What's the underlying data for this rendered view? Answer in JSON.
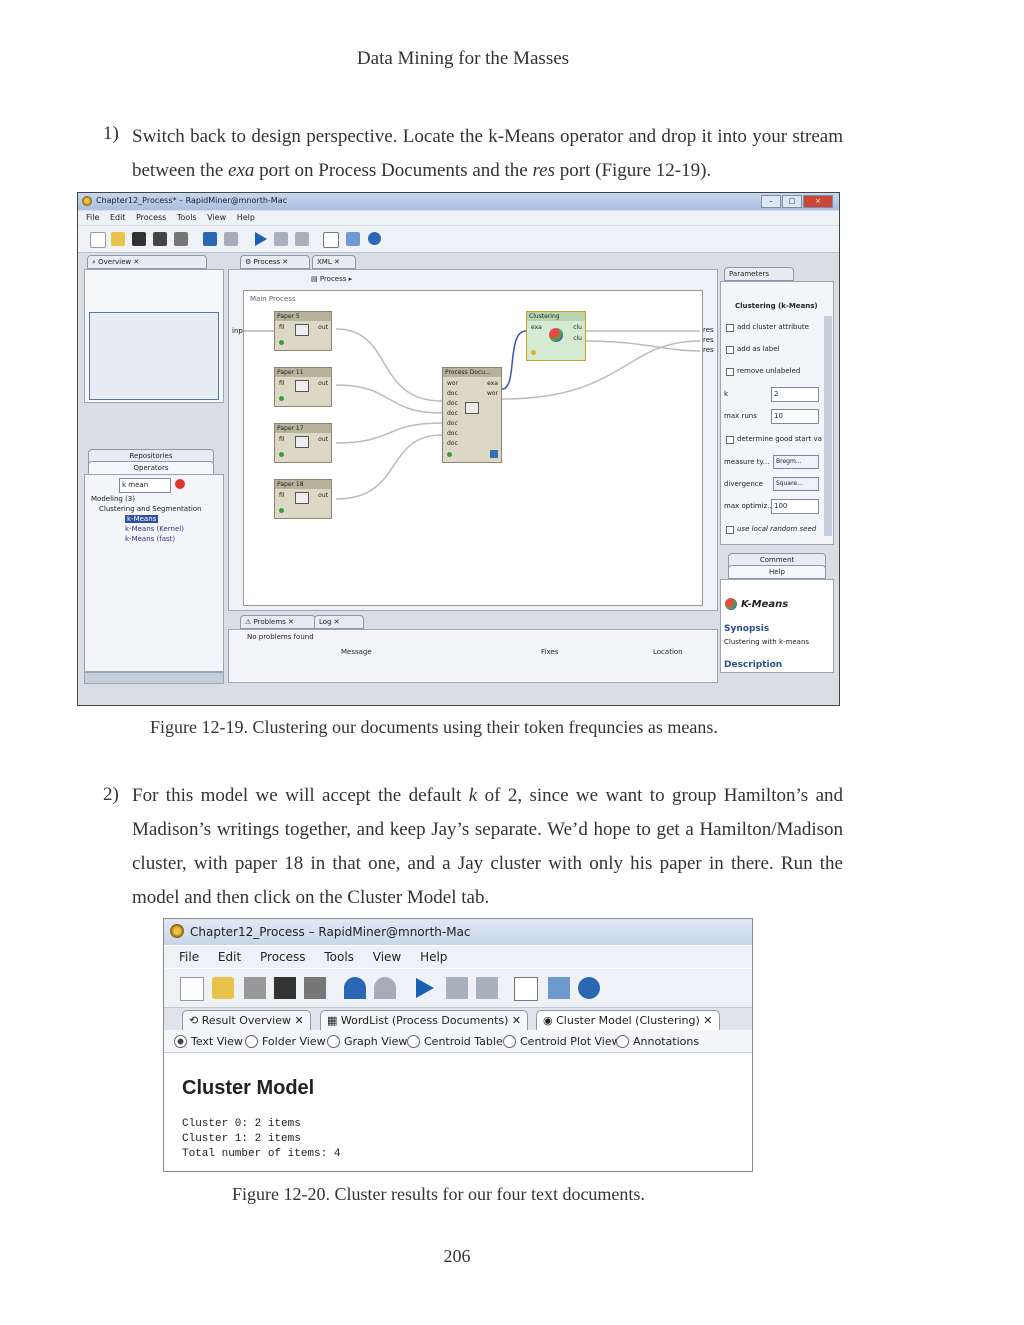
{
  "header": "Data Mining for the Masses",
  "steps": [
    {
      "number": "1)",
      "text": "Switch back to design perspective.  Locate the k-Means operator and drop it into your stream between the exa port on Process Documents and the res port (Figure 12-19)."
    },
    {
      "number": "2)",
      "text": "For this model we will accept the default k of 2, since we want to group Hamilton’s and Madison’s writings together, and keep Jay’s separate.   We’d hope to get a Hamilton/Madison cluster, with paper 18 in that one, and a Jay cluster with only his paper in there.  Run the model and then click on the Cluster Model tab."
    }
  ],
  "step1_parts": {
    "a": "Switch back to design perspective.  Locate the k-Means operator and drop it into your stream between the ",
    "exa": "exa",
    "b": " port on Process Documents and the ",
    "res": "res",
    "c": " port (Figure 12-19)."
  },
  "step2_parts": {
    "a": "For this model we will accept the default ",
    "k": "k",
    "b": " of 2, since we want to group Hamilton’s and Madison’s writings together, and keep Jay’s separate.   We’d hope to get a Hamilton/Madison cluster, with paper 18 in that one, and a Jay cluster with only his paper in there.  Run the model and then click on the Cluster Model tab."
  },
  "figure1": {
    "caption": "Figure 12-19.  Clustering our documents using their token frequncies as means.",
    "window_title": "Chapter12_Process* – RapidMiner@mnorth-Mac",
    "menu": [
      "File",
      "Edit",
      "Process",
      "Tools",
      "View",
      "Help"
    ],
    "overview_tab": "Overview",
    "process_tab": "Process",
    "xml_tab": "XML",
    "breadcrumb": "Process",
    "main_process_label": "Main Process",
    "operators": [
      {
        "name": "Paper 5",
        "port_in": "fil",
        "port_out": "out"
      },
      {
        "name": "Paper 11",
        "port_in": "fil",
        "port_out": "out"
      },
      {
        "name": "Paper 17",
        "port_in": "fil",
        "port_out": "out"
      },
      {
        "name": "Paper 18",
        "port_in": "fil",
        "port_out": "out"
      }
    ],
    "process_docs": {
      "name": "Process Docu...",
      "ports_in": [
        "wor",
        "doc",
        "doc",
        "doc",
        "doc",
        "doc",
        "doc"
      ],
      "ports_out": [
        "exa",
        "wor"
      ]
    },
    "clustering_op": {
      "name": "Clustering",
      "port_in": "exa",
      "ports_out": [
        "clu",
        "clu"
      ]
    },
    "canvas_left_port": "inp",
    "res_ports": [
      "res",
      "res",
      "res"
    ],
    "repositories_tab": "Repositories",
    "operators_tab": "Operators",
    "search_value": "k mean",
    "tree": [
      "Modeling (3)",
      "Clustering and Segmentation",
      "k-Means",
      "k-Means (Kernel)",
      "k-Means (fast)"
    ],
    "problems_tab": "Problems",
    "log_tab": "Log",
    "no_problems": "No problems found",
    "problem_columns": [
      "Message",
      "Fixes",
      "Location"
    ],
    "parameters_tab": "Parameters",
    "parameters_title": "Clustering (k-Means)",
    "params": {
      "add_cluster_attribute": "add cluster attribute",
      "add_as_label": "add as label",
      "remove_unlabeled": "remove unlabeled",
      "k_label": "k",
      "k_value": "2",
      "max_runs_label": "max runs",
      "max_runs_value": "10",
      "determine_good_start": "determine good start va",
      "measure_types_label": "measure ty...",
      "measure_types_value": "Bregm...",
      "divergence_label": "divergence",
      "divergence_value": "Square...",
      "max_optimization_label": "max optimiz...",
      "max_optimization_value": "100",
      "use_local_random_seed": "use local random seed"
    },
    "comment_tab": "Comment",
    "help_tab": "Help",
    "help_title": "K-Means",
    "help_synopsis_heading": "Synopsis",
    "help_synopsis": "Clustering with k-means",
    "help_description": "Description"
  },
  "figure2": {
    "caption": "Figure 12-20.  Cluster results for our four text documents.",
    "window_title": "Chapter12_Process – RapidMiner@mnorth-Mac",
    "menu": [
      "File",
      "Edit",
      "Process",
      "Tools",
      "View",
      "Help"
    ],
    "tabs": [
      "Result Overview",
      "WordList (Process Documents)",
      "Cluster Model (Clustering)"
    ],
    "views": [
      "Text View",
      "Folder View",
      "Graph View",
      "Centroid Table",
      "Centroid Plot View",
      "Annotations"
    ],
    "selected_view": "Text View",
    "heading": "Cluster Model",
    "lines": [
      "Cluster 0: 2 items",
      "Cluster 1: 2 items",
      "Total number of items: 4"
    ]
  },
  "page_number": "206"
}
